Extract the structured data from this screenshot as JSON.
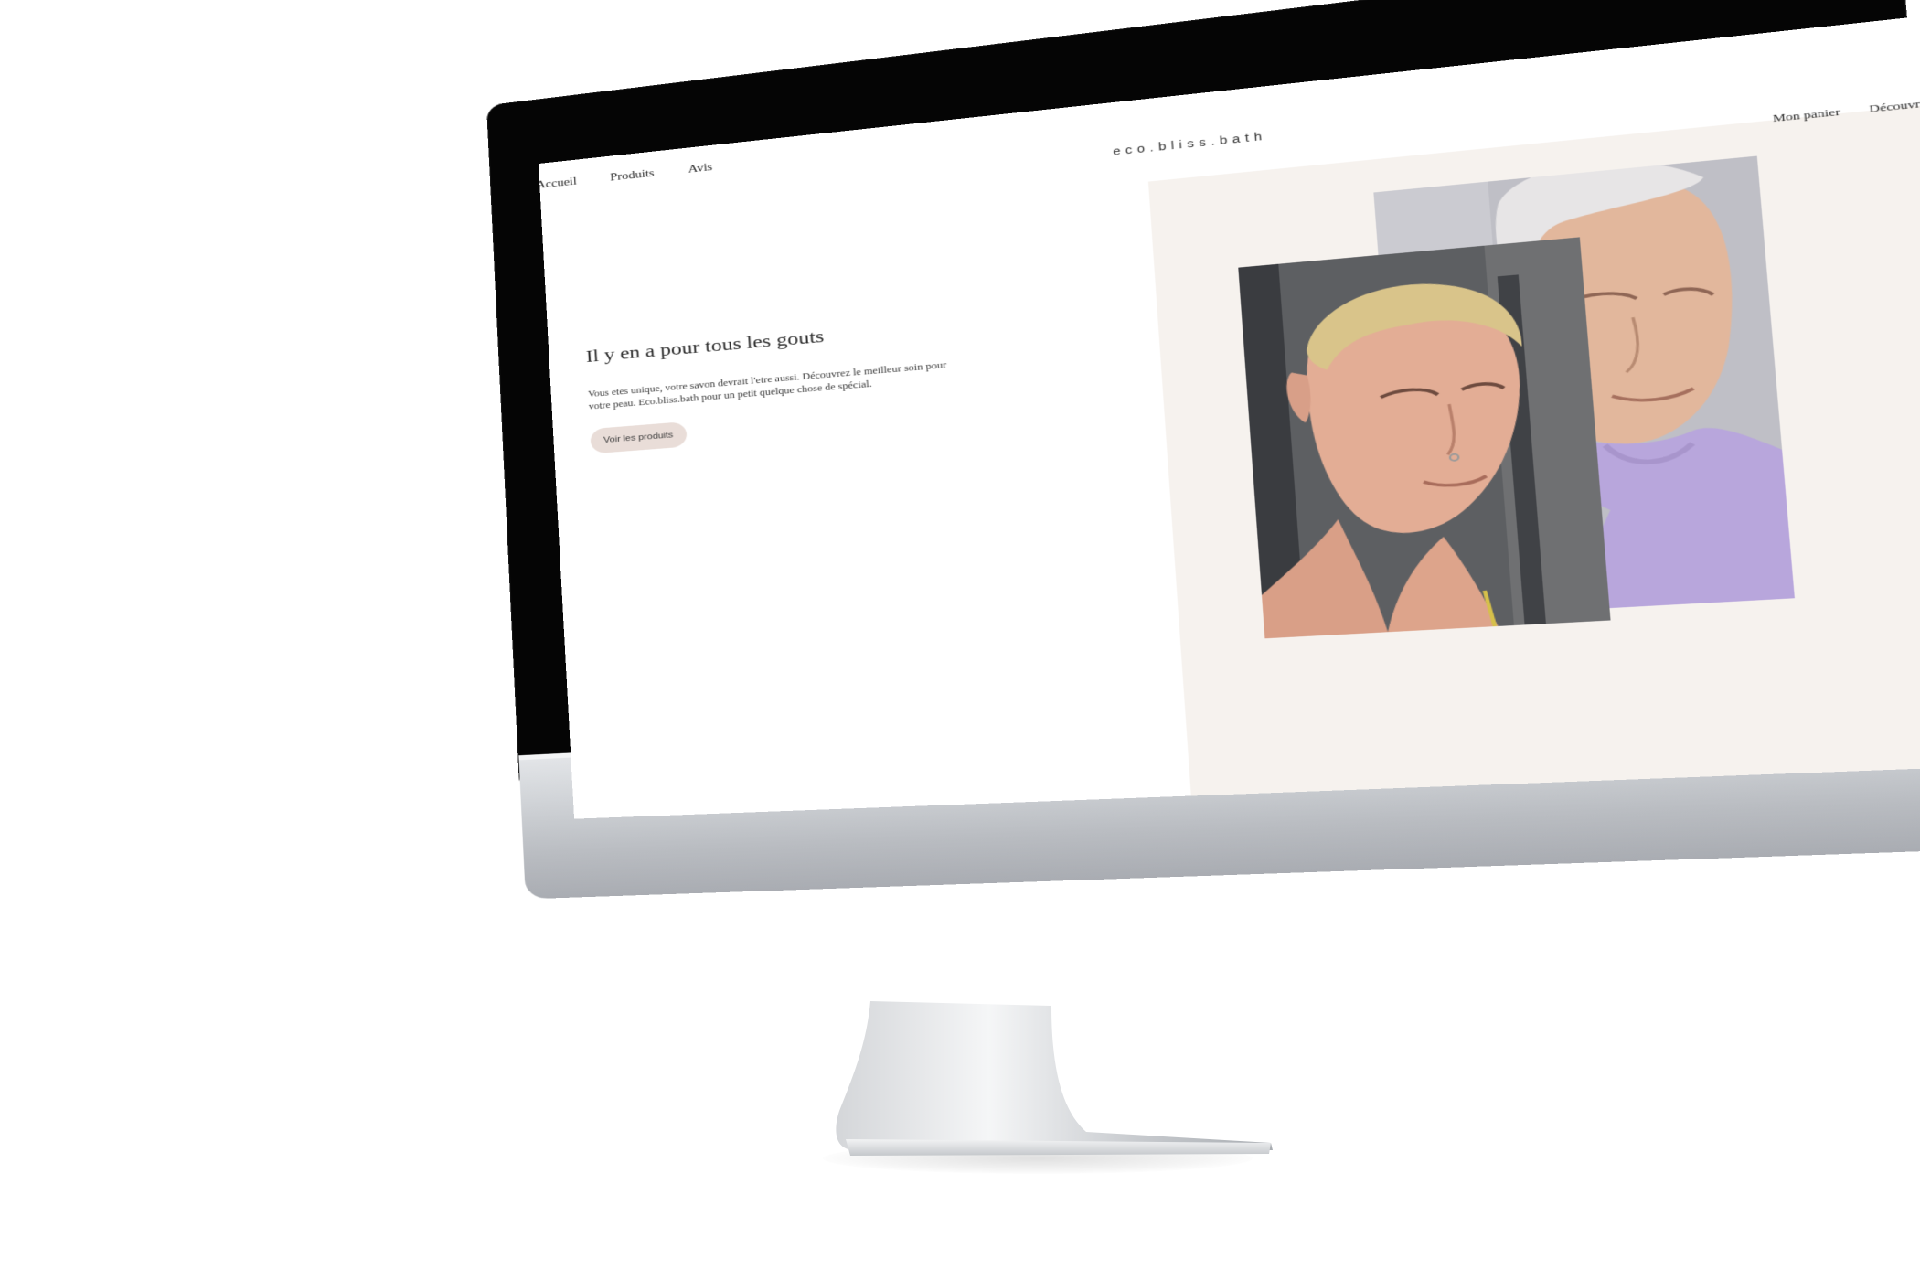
{
  "site": {
    "logo": "eco.bliss.bath"
  },
  "nav": {
    "left": [
      {
        "label": "Accueil"
      },
      {
        "label": "Produits"
      },
      {
        "label": "Avis"
      }
    ],
    "right": [
      {
        "label": "Mon panier"
      },
      {
        "label": "Découvrir"
      }
    ]
  },
  "hero": {
    "title": "Il y en a pour tous les gouts",
    "text": "Vous etes unique, votre savon devrait l'etre aussi. Découvrez le meilleur soin pour votre peau. Eco.bliss.bath pour un petit quelque chose de spécial.",
    "button_label": "Voir les produits"
  },
  "colors": {
    "panel_bg": "#f6f2ee",
    "button_bg": "#e9ddd8",
    "bezel": "#050505"
  }
}
